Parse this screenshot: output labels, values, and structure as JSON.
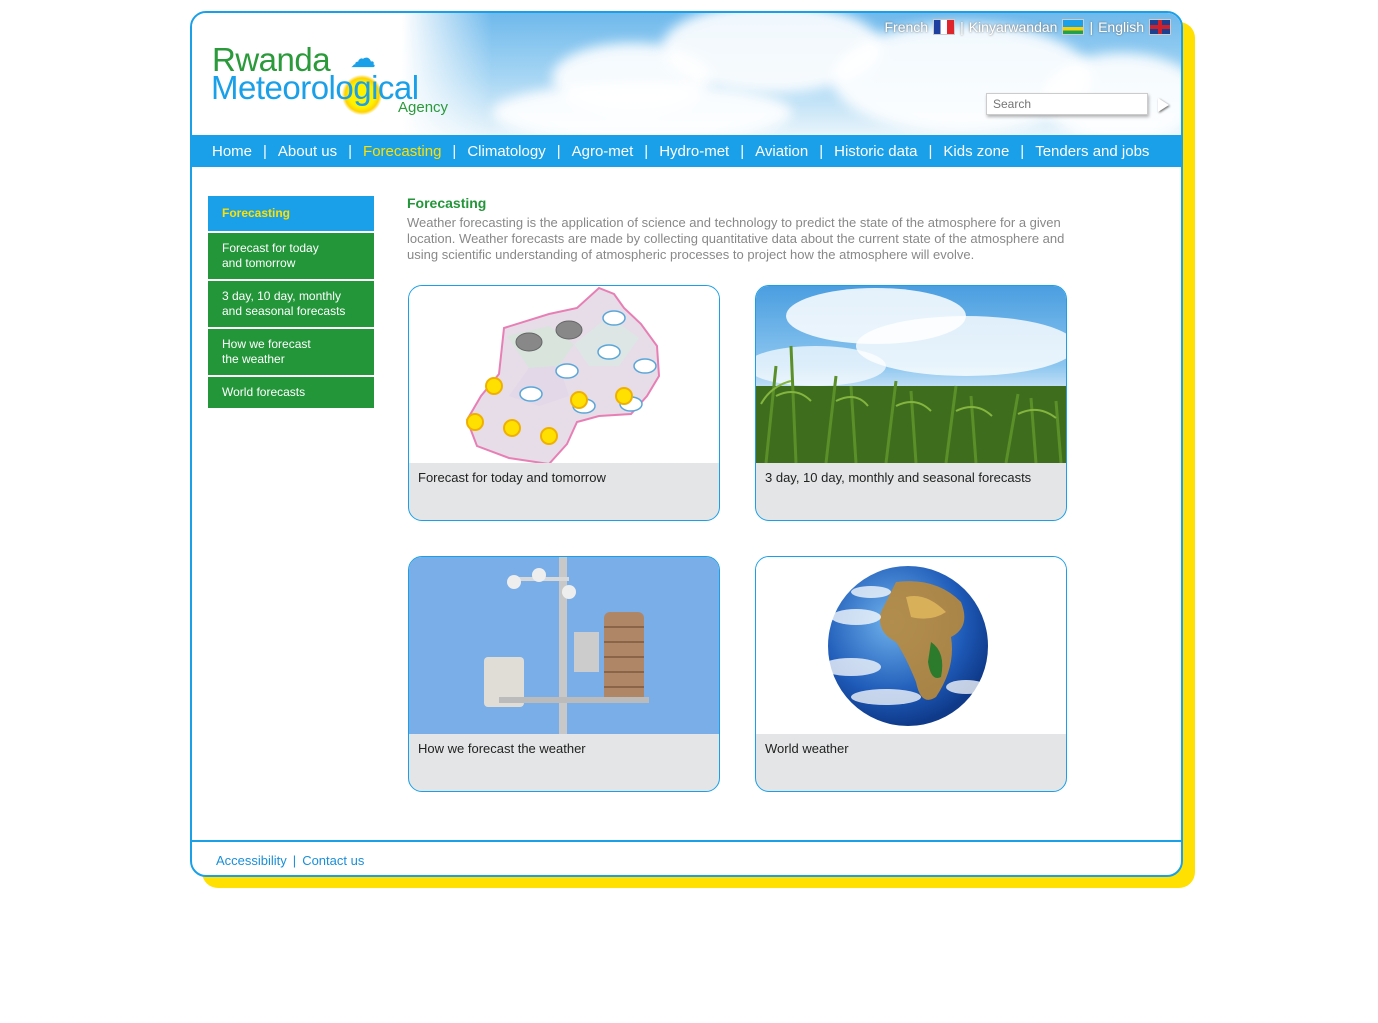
{
  "header": {
    "logo": {
      "line1": "Rwanda",
      "line2": "Meteorological",
      "line3": "Agency"
    },
    "languages": [
      {
        "label": "French",
        "flag": "flag-france-icon"
      },
      {
        "label": "Kinyarwandan",
        "flag": "flag-rwanda-icon"
      },
      {
        "label": "English",
        "flag": "flag-uk-icon"
      }
    ],
    "search": {
      "placeholder": "Search"
    }
  },
  "nav": {
    "items": [
      "Home",
      "About us",
      "Forecasting",
      "Climatology",
      "Agro-met",
      "Hydro-met",
      "Aviation",
      "Historic data",
      "Kids zone",
      "Tenders and jobs"
    ],
    "active": "Forecasting"
  },
  "sidebar": {
    "title": "Forecasting",
    "items": [
      {
        "line1": "Forecast for today",
        "line2": "and tomorrow"
      },
      {
        "line1": "3 day, 10 day, monthly",
        "line2": "and seasonal forecasts"
      },
      {
        "line1": "How we forecast",
        "line2": "the weather"
      },
      {
        "line1": "World forecasts",
        "line2": ""
      }
    ]
  },
  "main": {
    "title": "Forecasting",
    "intro": "Weather forecasting is the application of science and technology to predict the state of the atmosphere for a given location. Weather forecasts are made by collecting quantitative data about the current state of the atmosphere and using scientific understanding of atmospheric processes to project how the atmosphere will evolve.",
    "cards": [
      {
        "label": "Forecast for today and tomorrow",
        "image": "rwanda-forecast-map-image"
      },
      {
        "label": "3 day, 10 day, monthly and seasonal forecasts",
        "image": "cornfield-sky-image"
      },
      {
        "label": "How we forecast the weather",
        "image": "weather-station-image"
      },
      {
        "label": "World weather",
        "image": "earth-globe-image"
      }
    ]
  },
  "footer": {
    "links": [
      "Accessibility",
      "Contact us"
    ]
  },
  "colors": {
    "brand_blue": "#1aa0e8",
    "brand_green": "#23963a",
    "accent_yellow": "#ffe000"
  }
}
